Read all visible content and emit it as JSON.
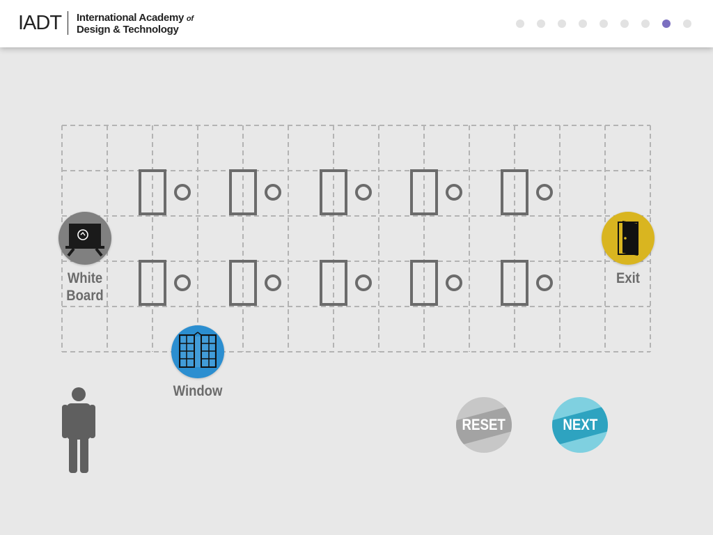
{
  "header": {
    "logo_mark": "IADT",
    "logo_line1": "International Academy",
    "logo_line1_suffix": "of",
    "logo_line2": "Design & Technology",
    "page_dots_total": 9,
    "page_dots_active": 8
  },
  "room": {
    "grid_cols": 13,
    "grid_rows": 5,
    "desk_rows": 2,
    "desk_cols": 5,
    "whiteboard_label_line1": "White",
    "whiteboard_label_line2": "Board",
    "window_label": "Window",
    "exit_label": "Exit"
  },
  "icons": {
    "whiteboard": "whiteboard-icon",
    "window": "window-icon",
    "exit": "door-icon",
    "person": "person-icon"
  },
  "controls": {
    "reset_label": "RESET",
    "next_label": "NEXT"
  },
  "colors": {
    "accent_active_dot": "#7b6fc0",
    "next_button": "#2ea3c0",
    "reset_button": "#a3a3a3",
    "exit_icon": "#d9b520",
    "window_icon": "#2b8ed0",
    "whiteboard_icon": "#6b6b6b"
  }
}
